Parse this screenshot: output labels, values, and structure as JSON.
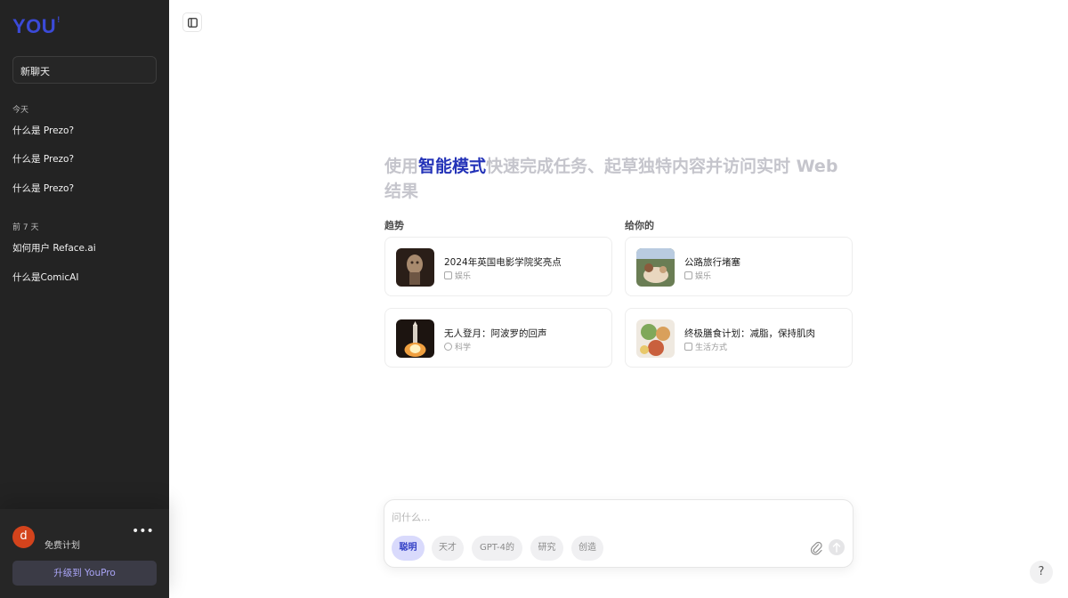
{
  "sidebar": {
    "logo": "YOU",
    "new_chat": "新聊天",
    "sections": [
      {
        "label": "今天",
        "items": [
          "什么是 Prezo?",
          "什么是 Prezo?",
          "什么是 Prezo?"
        ]
      },
      {
        "label": "前 7 天",
        "items": [
          "如何用户 Reface.ai",
          "什么是ComicAI"
        ]
      }
    ],
    "user": {
      "avatar_letter": "d",
      "plan": "免费计划",
      "more": "•••",
      "upgrade": "升级到 YouPro"
    }
  },
  "hero": {
    "prefix": "使用",
    "highlight": "智能模式",
    "suffix": "快速完成任务、起草独特内容并访问实时 Web 结果"
  },
  "columns": {
    "trending": "趋势",
    "for_you": "给你的"
  },
  "cards": [
    {
      "title": "2024年英国电影学院奖亮点",
      "category": "娱乐"
    },
    {
      "title": "公路旅行堵塞",
      "category": "娱乐"
    },
    {
      "title": "无人登月：阿波罗的回声",
      "category": "科学"
    },
    {
      "title": "终极膳食计划：减脂，保持肌肉",
      "category": "生活方式"
    }
  ],
  "composer": {
    "placeholder": "问什么...",
    "modes": [
      "聪明",
      "天才",
      "GPT-4的",
      "研究",
      "创造"
    ],
    "active_mode": "聪明"
  },
  "help": "?",
  "colors": {
    "accent": "#2433b8",
    "sidebar_bg": "#232323",
    "avatar": "#d3431c",
    "chip_active": "#d9dafc"
  }
}
